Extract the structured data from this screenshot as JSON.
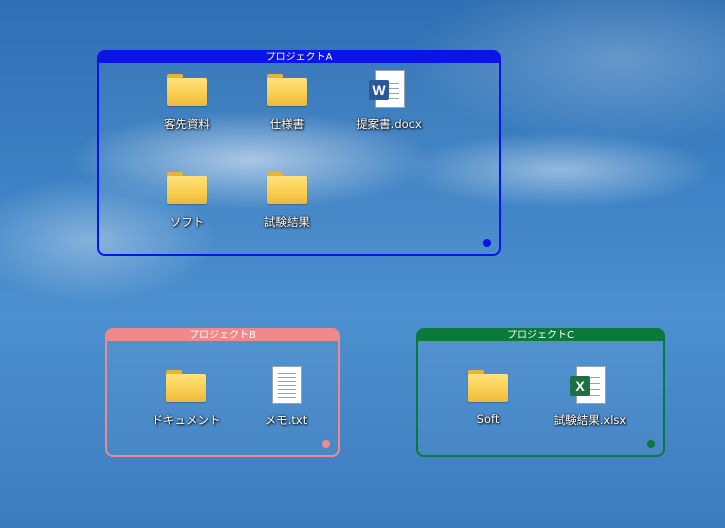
{
  "colors": {
    "fence_a": "#0a14e6",
    "fence_b": "#f08a8a",
    "fence_c": "#0a7a3a",
    "word": "#2b5797",
    "excel": "#1d7044"
  },
  "fences": {
    "a": {
      "title": "プロジェクトA",
      "items": [
        {
          "label": "客先資料",
          "icon": "folder-icon"
        },
        {
          "label": "仕様書",
          "icon": "folder-icon"
        },
        {
          "label": "提案書.docx",
          "icon": "word-document-icon",
          "badge": "W"
        },
        {
          "label": "ソフト",
          "icon": "folder-icon"
        },
        {
          "label": "試験結果",
          "icon": "folder-icon"
        }
      ]
    },
    "b": {
      "title": "プロジェクトB",
      "items": [
        {
          "label": "ドキュメント",
          "icon": "folder-icon"
        },
        {
          "label": "メモ.txt",
          "icon": "text-document-icon"
        }
      ]
    },
    "c": {
      "title": "プロジェクトC",
      "items": [
        {
          "label": "Soft",
          "icon": "folder-icon"
        },
        {
          "label": "試験結果.xlsx",
          "icon": "excel-document-icon",
          "badge": "X"
        }
      ]
    }
  }
}
